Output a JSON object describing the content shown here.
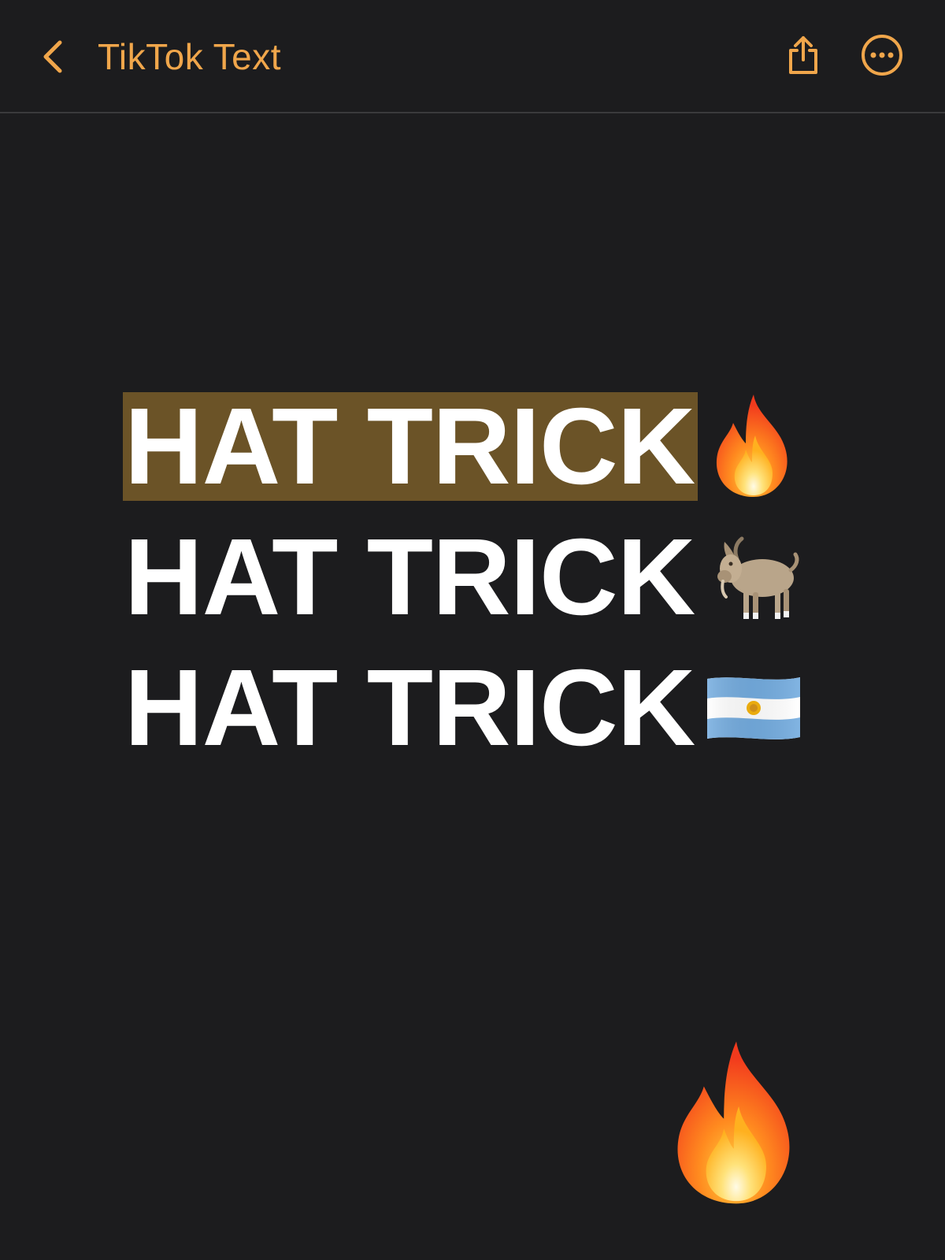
{
  "header": {
    "title": "TikTok Text",
    "accent_color": "#f0a64b",
    "back_icon": "chevron-left-icon",
    "share_icon": "share-icon",
    "more_icon": "more-options-icon"
  },
  "note": {
    "lines": [
      {
        "text": "HAT TRICK",
        "emoji": "fire-emoji",
        "highlighted": true
      },
      {
        "text": "HAT TRICK",
        "emoji": "goat-emoji",
        "highlighted": false
      },
      {
        "text": "HAT TRICK",
        "emoji": "argentina-flag-emoji",
        "highlighted": false
      }
    ],
    "highlight_color": "#6b5327",
    "text_color": "#ffffff",
    "standalone_emoji": "fire-emoji"
  },
  "colors": {
    "background": "#1c1c1e",
    "divider": "#3a3a3c"
  }
}
